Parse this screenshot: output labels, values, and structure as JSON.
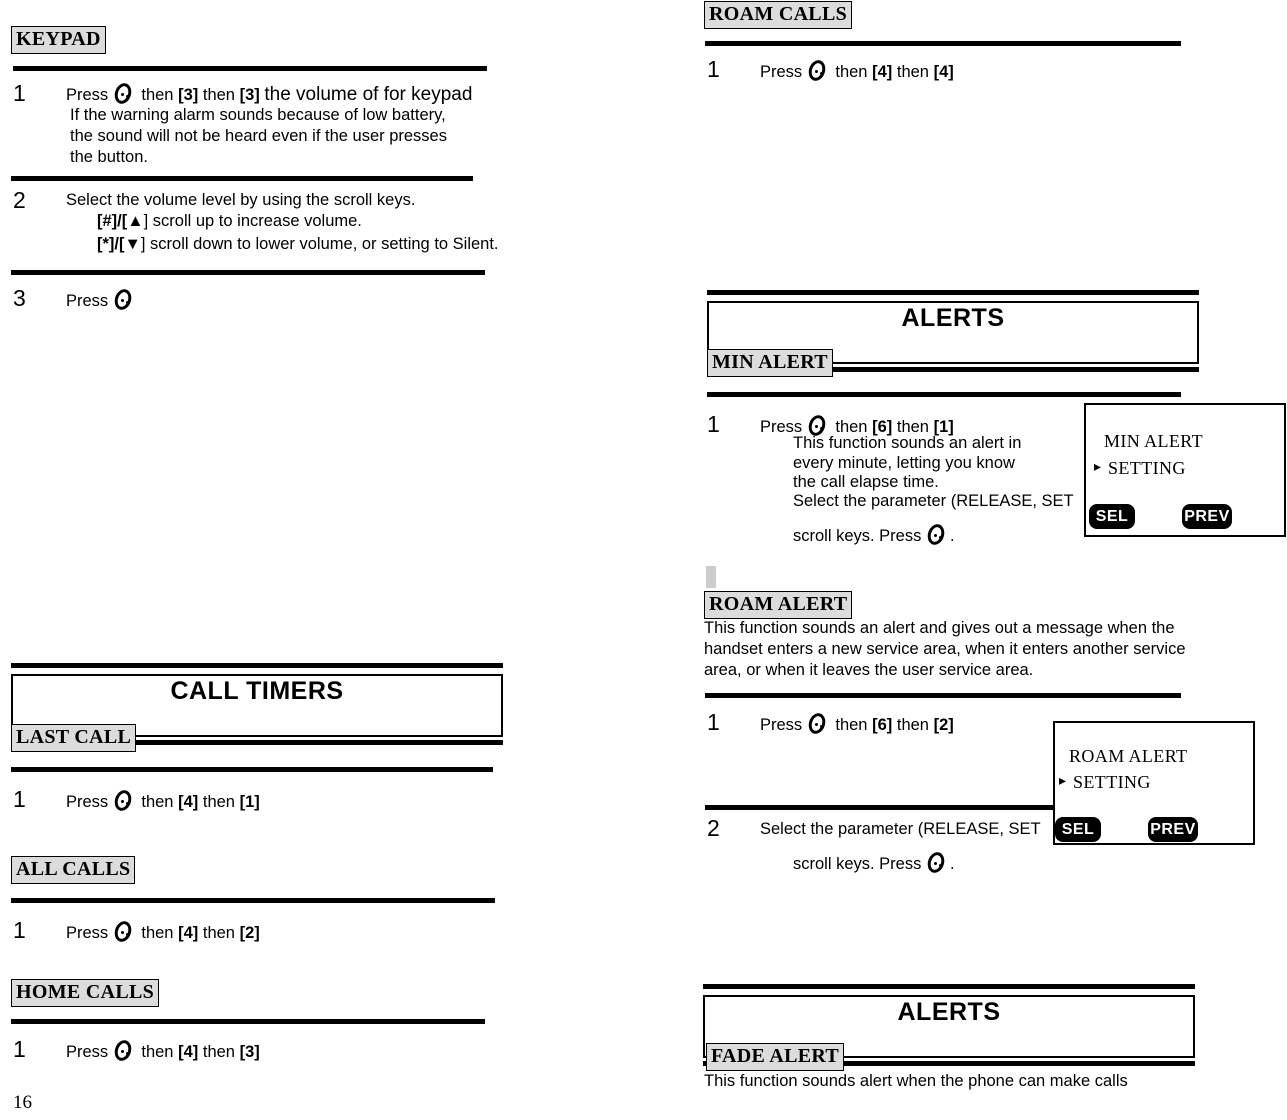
{
  "page": {
    "number": "16"
  },
  "icons": {
    "send_key": "send-key-icon"
  },
  "left_column": {
    "keypad": {
      "label": "KEYPAD",
      "steps": [
        {
          "num": "1",
          "lead": "Press",
          "mid1": "then",
          "key1": "[3]",
          "mid2": "then",
          "key2": "[3]",
          "tail": "the volume of for keypad",
          "note": "If the warning alarm sounds because of low battery, the sound will not be heard even if the user presses the button."
        },
        {
          "num": "2",
          "line1": "Select the volume level by using the scroll keys.",
          "sub1_bold": "[#]",
          "sub1_mid": "/[",
          "sub1_arrow": "▲",
          "sub1_tail": "] scroll up to increase volume.",
          "sub2_bold": "[*]",
          "sub2_mid": "/[",
          "sub2_arrow": "▼",
          "sub2_tail": "] scroll down to lower volume, or setting to Silent."
        },
        {
          "num": "3",
          "lead": "Press"
        }
      ]
    },
    "call_timers": {
      "title": "CALL TIMERS",
      "sections": [
        {
          "label": "LAST CALL",
          "step_num": "1",
          "lead": "Press",
          "mid1": "then",
          "key1": "[4]",
          "mid2": "then",
          "key2": "[1]"
        },
        {
          "label": "ALL CALLS",
          "step_num": "1",
          "lead": "Press",
          "mid1": "then",
          "key1": "[4]",
          "mid2": "then",
          "key2": "[2]"
        },
        {
          "label": "HOME CALLS",
          "step_num": "1",
          "lead": "Press",
          "mid1": "then",
          "key1": "[4]",
          "mid2": "then",
          "key2": "[3]"
        }
      ]
    }
  },
  "right_column": {
    "roam_calls": {
      "label": "ROAM CALLS",
      "step_num": "1",
      "lead": "Press",
      "mid1": "then",
      "key1": "[4]",
      "mid2": "then",
      "key2": "[4]"
    },
    "alerts_1": {
      "title": "ALERTS",
      "label": "MIN ALERT",
      "step_num": "1",
      "lead": "Press",
      "mid1": "then",
      "key1": "[6]",
      "mid2": "then",
      "key2": "[1]",
      "note_line1": "This function sounds an alert in",
      "note_line2": "every minute, letting you know",
      "note_line3": "the call elapse time.",
      "note_line4": "Select the parameter (RELEASE, SET",
      "note_line5a": "scroll keys. Press",
      "note_line5b": ".",
      "lcd": {
        "line1": "MIN ALERT",
        "caret": "▸",
        "line2": "SETTING",
        "softkey_left": "SEL",
        "softkey_right": "PREV"
      }
    },
    "roam_alert": {
      "label": "ROAM ALERT",
      "description": "This function sounds an alert and gives out a message when the handset enters a new service area, when it enters another service area, or when it leaves the user service area.",
      "steps": [
        {
          "num": "1",
          "lead": "Press",
          "mid1": "then",
          "key1": "[6]",
          "mid2": "then",
          "key2": "[2]"
        },
        {
          "num": "2",
          "line1": "Select the parameter (RELEASE, SET",
          "line2a": "scroll keys. Press",
          "line2b": "."
        }
      ],
      "lcd": {
        "line1": "ROAM ALERT",
        "caret": "▸",
        "line2": "SETTING",
        "softkey_left": "SEL",
        "softkey_right": "PREV"
      }
    },
    "alerts_2": {
      "title": "ALERTS",
      "label": "FADE ALERT",
      "description": "This function sounds alert when the phone can make calls"
    }
  }
}
